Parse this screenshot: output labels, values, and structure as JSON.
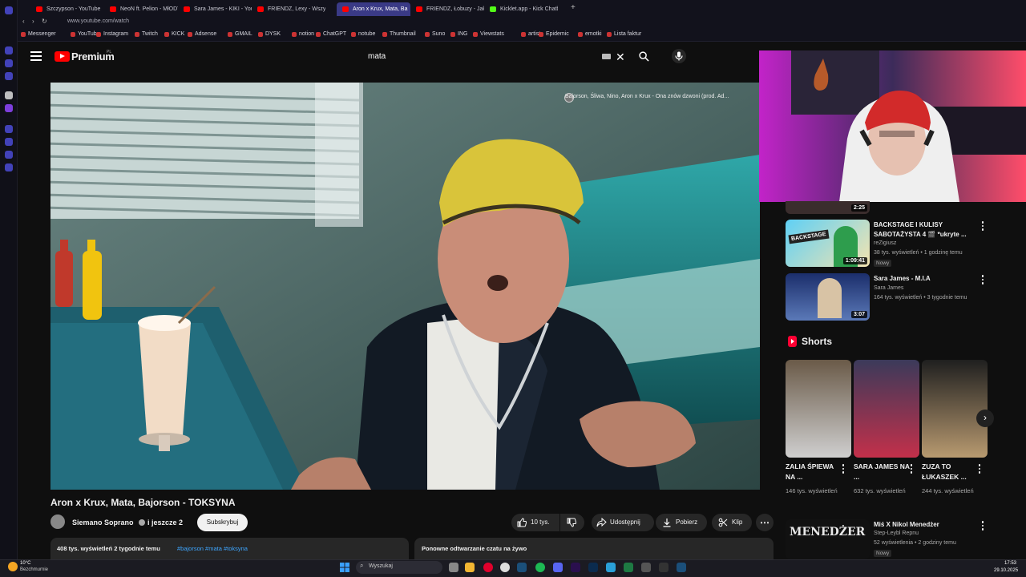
{
  "browser": {
    "tabs": [
      {
        "label": "Szczypson - YouTube",
        "color": "#ff0000"
      },
      {
        "label": "NeoN ft. Pelion - MłODY",
        "color": "#ff0000"
      },
      {
        "label": "Sara James - KIKI - YouT",
        "color": "#ff0000"
      },
      {
        "label": "FRIENDZ, Lexy - Wszystk",
        "color": "#ff0000"
      },
      {
        "label": "Aron x Krux, Mata, Ba",
        "color": "#ff0000"
      },
      {
        "label": "FRIENDZ, Łobuzy - Jak ta",
        "color": "#ff0000"
      },
      {
        "label": "Kicklet.app - Kick Chatbo",
        "color": "#53fc18"
      }
    ],
    "active_tab_index": 4,
    "url": "www.youtube.com/watch",
    "bookmarks": [
      "Messenger",
      "YouTube",
      "Instagram",
      "Twitch",
      "KICK",
      "Adsense",
      "GMAIL",
      "DYSK",
      "notion",
      "ChatGPT",
      "notube",
      "Thumbnail",
      "Suno",
      "ING",
      "Viewstats",
      "artist",
      "Epidemic",
      "emotki",
      "Lista faktur"
    ]
  },
  "header": {
    "logo_text": "Premium",
    "region": "PL",
    "search_value": "mata",
    "icons": [
      "menu-icon",
      "youtube-logo-icon",
      "keyboard-icon",
      "close-icon",
      "search-icon",
      "mic-icon"
    ]
  },
  "video": {
    "overlay_title": "Bajorson, Śliwa, Nino, Aron x Krux - Ona znów dzwoni (prod. Ad...",
    "title": "Aron x Krux, Mata, Bajorson - TOKSYNA",
    "channel": "Siemano Soprano",
    "collab": "i jeszcze 2",
    "subscribe_label": "Subskrybuj",
    "likes": "10 tys.",
    "share_label": "Udostępnij",
    "download_label": "Pobierz",
    "clip_label": "Klip",
    "description": {
      "stats": "408 tys. wyświetleń  2 tygodnie temu",
      "tags": "#bajorson #mata #toksyna"
    },
    "chat_replay": "Ponowne odtwarzanie czatu na żywo"
  },
  "sidebar": {
    "top_partial_duration": "2:25",
    "recommendations": [
      {
        "title": "BACKSTAGE I KULISY SABOTAŻYSTA 4 🎬 *ukryte ...",
        "channel": "reZigiusz",
        "meta": "38 tys. wyświetleń • 1 godzinę temu",
        "badge": "Nowy",
        "duration": "1:09:41",
        "thumb_text": "BACKSTAGE"
      },
      {
        "title": "Sara James - M.I.A",
        "channel": "Sara James",
        "meta": "164 tys. wyświetleń • 3 tygodnie temu",
        "badge": "",
        "duration": "3:07",
        "thumb_text": ""
      }
    ],
    "shorts_heading": "Shorts",
    "shorts": [
      {
        "title": "ZALIA ŚPIEWA NA ...",
        "views": "146 tys. wyświetleń"
      },
      {
        "title": "SARA JAMES NA ...",
        "views": "632 tys. wyświetleń"
      },
      {
        "title": "ZUZA TO ŁUKASZEK ...",
        "views": "244 tys. wyświetleń"
      }
    ],
    "bottom_recommendation": {
      "title": "Miś X Nikol  Menedżer",
      "channel": "Step-Leybl Repnu",
      "meta": "52 wyświetlenia • 2 godziny temu",
      "badge": "Nowy",
      "thumb_text": "MENEDŻER"
    }
  },
  "taskbar": {
    "weather_temp": "10°C",
    "weather_desc": "Bezchmurnie",
    "search_label": "Wyszukaj",
    "time": "17:53",
    "date": "29.10.2025"
  },
  "colors": {
    "youtube_red": "#ff0000",
    "background": "#0f0f0f",
    "active_tab": "#3a3a86",
    "link_blue": "#3ea6ff"
  }
}
